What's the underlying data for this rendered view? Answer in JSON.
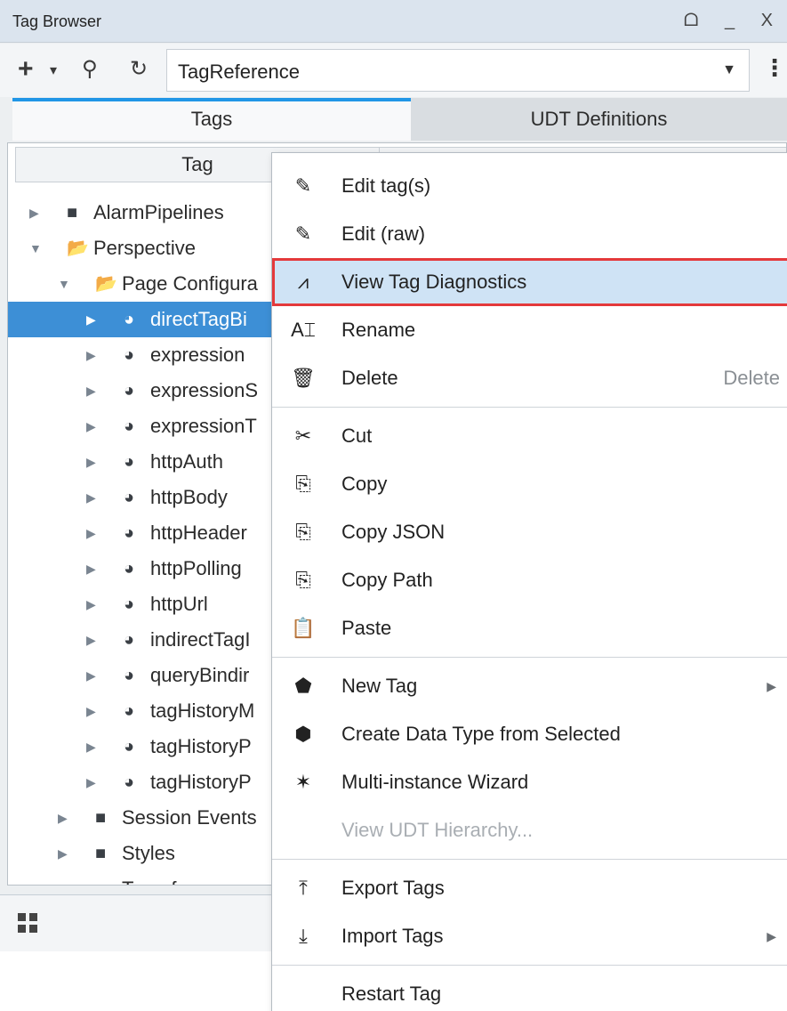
{
  "window": {
    "title": "Tag Browser",
    "controls": "ᗝ _ X"
  },
  "toolbar": {
    "add_icon": "+",
    "add_caret": "▾",
    "search_icon": "⚲",
    "refresh_icon": "↻",
    "provider_value": "TagReference",
    "provider_caret": "▼",
    "more_icon": "⋮"
  },
  "tabs": [
    {
      "label": "Tags",
      "active": true
    },
    {
      "label": "UDT Definitions",
      "active": false
    }
  ],
  "tree": {
    "column_header": "Tag",
    "items": [
      {
        "label": "AlarmPipelines",
        "type": "folder",
        "expanded": false,
        "selected": false
      },
      {
        "label": "Perspective",
        "type": "folder",
        "expanded": true,
        "selected": false
      },
      {
        "label": "Page Configura",
        "type": "folder",
        "expanded": true,
        "selected": false
      },
      {
        "label": "directTagBi",
        "type": "udt",
        "expanded": false,
        "selected": true
      },
      {
        "label": "expression",
        "type": "udt",
        "expanded": false,
        "selected": false
      },
      {
        "label": "expressionS",
        "type": "udt",
        "expanded": false,
        "selected": false
      },
      {
        "label": "expressionT",
        "type": "udt",
        "expanded": false,
        "selected": false
      },
      {
        "label": "httpAuth",
        "type": "udt",
        "expanded": false,
        "selected": false
      },
      {
        "label": "httpBody",
        "type": "udt",
        "expanded": false,
        "selected": false
      },
      {
        "label": "httpHeader",
        "type": "udt",
        "expanded": false,
        "selected": false
      },
      {
        "label": "httpPolling",
        "type": "udt",
        "expanded": false,
        "selected": false
      },
      {
        "label": "httpUrl",
        "type": "udt",
        "expanded": false,
        "selected": false
      },
      {
        "label": "indirectTagI",
        "type": "udt",
        "expanded": false,
        "selected": false
      },
      {
        "label": "queryBindir",
        "type": "udt",
        "expanded": false,
        "selected": false
      },
      {
        "label": "tagHistoryM",
        "type": "udt",
        "expanded": false,
        "selected": false
      },
      {
        "label": "tagHistoryP",
        "type": "udt",
        "expanded": false,
        "selected": false
      },
      {
        "label": "tagHistoryP",
        "type": "udt",
        "expanded": false,
        "selected": false
      },
      {
        "label": "Session Events",
        "type": "folder",
        "expanded": false,
        "selected": false
      },
      {
        "label": "Styles",
        "type": "folder",
        "expanded": false,
        "selected": false
      },
      {
        "label": "Transforms",
        "type": "folder",
        "expanded": false,
        "selected": false
      }
    ]
  },
  "context_menu": {
    "items": [
      {
        "label": "Edit tag(s)",
        "icon": "pencil-icon",
        "glyph": "✎"
      },
      {
        "label": "Edit (raw)",
        "icon": "pencil-icon",
        "glyph": "✎"
      },
      {
        "label": "View Tag Diagnostics",
        "icon": "pulse-icon",
        "glyph": "⩘",
        "highlighted": true
      },
      {
        "label": "Rename",
        "icon": "rename-icon",
        "glyph": "A⌶"
      },
      {
        "label": "Delete",
        "icon": "trash-icon",
        "glyph": "🗑",
        "shortcut": "Delete"
      },
      {
        "separator": true
      },
      {
        "label": "Cut",
        "icon": "scissors-icon",
        "glyph": "✂"
      },
      {
        "label": "Copy",
        "icon": "copy-icon",
        "glyph": "⎘"
      },
      {
        "label": "Copy JSON",
        "icon": "copy-json-icon",
        "glyph": "⎘"
      },
      {
        "label": "Copy Path",
        "icon": "copy-path-icon",
        "glyph": "⎘"
      },
      {
        "label": "Paste",
        "icon": "clipboard-icon",
        "glyph": "📋"
      },
      {
        "separator": true
      },
      {
        "label": "New Tag",
        "icon": "new-tag-icon",
        "glyph": "⬟",
        "submenu": true
      },
      {
        "label": "Create Data Type from Selected",
        "icon": "data-type-icon",
        "glyph": "⬢"
      },
      {
        "label": "Multi-instance Wizard",
        "icon": "wand-icon",
        "glyph": "✶"
      },
      {
        "label": "View UDT Hierarchy...",
        "icon": "",
        "glyph": "",
        "disabled": true
      },
      {
        "separator": true
      },
      {
        "label": "Export Tags",
        "icon": "export-icon",
        "glyph": "⤒"
      },
      {
        "label": "Import Tags",
        "icon": "import-icon",
        "glyph": "⤓",
        "submenu": true
      },
      {
        "separator": true
      },
      {
        "label": "Restart Tag",
        "icon": "",
        "glyph": ""
      }
    ],
    "submenu_glyph": "▶"
  },
  "colors": {
    "selection": "#3d8fd6",
    "active_tab_accent": "#2196e6",
    "highlight_outline": "#e4393b",
    "highlight_fill": "#cfe3f5"
  }
}
